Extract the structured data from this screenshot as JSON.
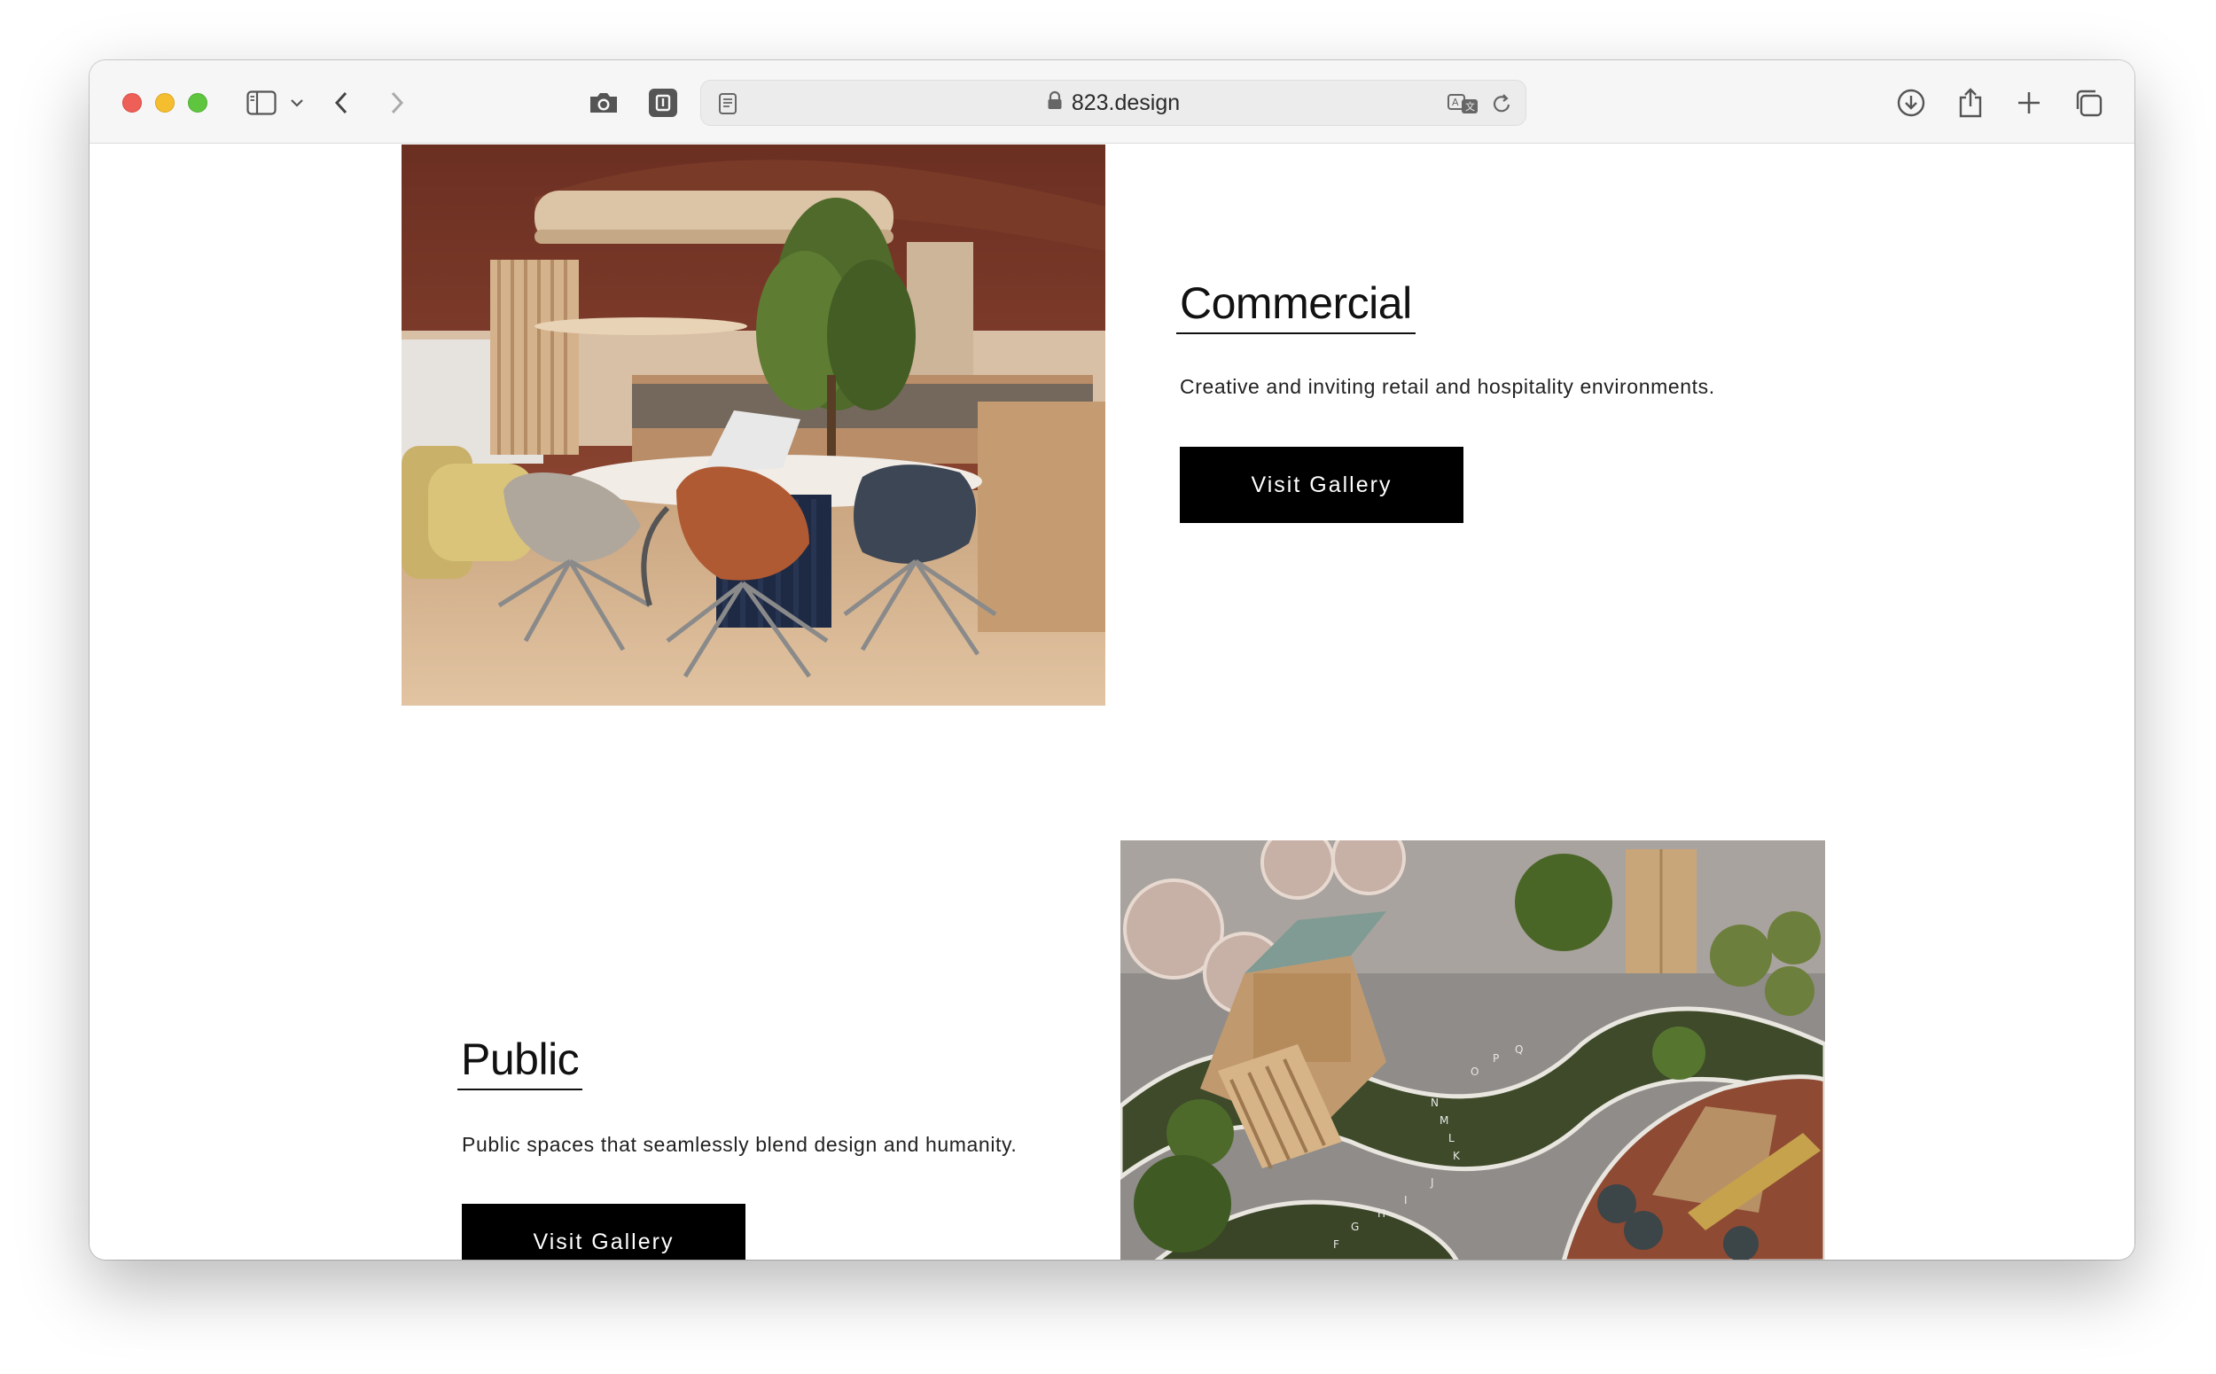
{
  "browser": {
    "url": "823.design",
    "icons": [
      "sidebar-icon",
      "chevron-down-icon",
      "back-icon",
      "forward-icon",
      "camera-icon",
      "extension-icon",
      "reader-icon",
      "lock-icon",
      "translate-icon",
      "reload-icon",
      "download-icon",
      "share-icon",
      "plus-icon",
      "tabs-icon"
    ],
    "traffic_colors": {
      "red": "#ee5f57",
      "yellow": "#f5be2e",
      "green": "#5fc53f"
    }
  },
  "sections": [
    {
      "title": "Commercial",
      "description": "Creative and inviting retail and hospitality environments.",
      "button": "Visit Gallery",
      "image": "office-lounge-interior"
    },
    {
      "title": "Public",
      "description": "Public spaces that seamlessly blend design and humanity.",
      "button": "Visit Gallery",
      "image": "children-playground-render"
    }
  ],
  "colors": {
    "button_bg": "#000000",
    "button_text": "#ffffff",
    "text": "#111111"
  }
}
